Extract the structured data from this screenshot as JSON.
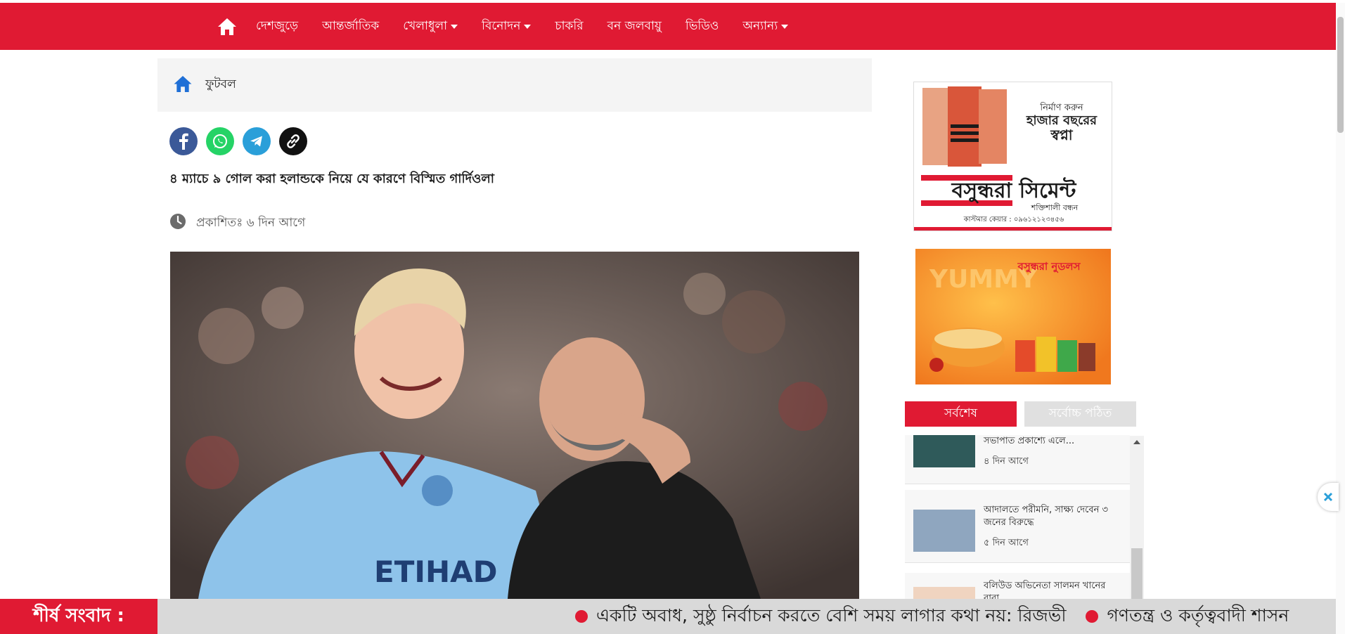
{
  "nav": {
    "items": [
      {
        "label": "দেশজুড়ে",
        "dropdown": false
      },
      {
        "label": "আন্তর্জাতিক",
        "dropdown": false
      },
      {
        "label": "খেলাধুলা",
        "dropdown": true
      },
      {
        "label": "বিনোদন",
        "dropdown": true
      },
      {
        "label": "চাকরি",
        "dropdown": false
      },
      {
        "label": "বন জলবায়ু",
        "dropdown": false
      },
      {
        "label": "ভিডিও",
        "dropdown": false
      },
      {
        "label": "অন্যান্য",
        "dropdown": true
      }
    ]
  },
  "breadcrumb": {
    "category": "ফুটবল"
  },
  "article": {
    "headline": "৪ ম্যাচে ৯ গোল করা হলান্ডকে নিয়ে যে কারণে বিস্মিত গার্দিওলা",
    "published": "প্রকাশিতঃ ৬ দিন আগে"
  },
  "ads": {
    "ad1": {
      "tagline1": "নির্মাণ করুন",
      "tagline2": "হাজার বছরের",
      "tagline3": "স্বপ্না",
      "brand": "বসুন্ধরা সিমেন্ট",
      "sub": "শক্তিশালী বন্ধন",
      "care": "কাস্টমার কেয়ার : ০৯৬১২১২৩৪৫৬"
    },
    "ad2": {
      "brand": "বসুন্ধরা নুডলস",
      "word": "YUMMY"
    }
  },
  "tabs": {
    "latest": "সর্বশেষ",
    "most_read": "সর্বোচ্চ পঠিত"
  },
  "news": [
    {
      "title": "সভাপাত প্রকাশ্যে এলে...",
      "time": "৪ দিন আগে"
    },
    {
      "title": "আদালতে পরীমনি, সাক্ষ্য দেবেন ৩ জনের বিরুদ্ধে",
      "time": "৫ দিন আগে"
    },
    {
      "title": "বলিউড অভিনেতা সালমন খানের বাবা",
      "time": ""
    }
  ],
  "ticker": {
    "label": "শীর্ষ সংবাদ :",
    "items": [
      "একটি অবাধ, সুষ্ঠু নির্বাচন করতে বেশি সময় লাগার কথা নয়: রিজভী",
      "গণতন্ত্র ও কর্তৃত্ববাদী শাসন"
    ]
  },
  "colors": {
    "brand_red": "#e01a33",
    "facebook": "#3b5998",
    "whatsapp": "#25d366",
    "telegram": "#2a9fd9",
    "link": "#111111"
  }
}
